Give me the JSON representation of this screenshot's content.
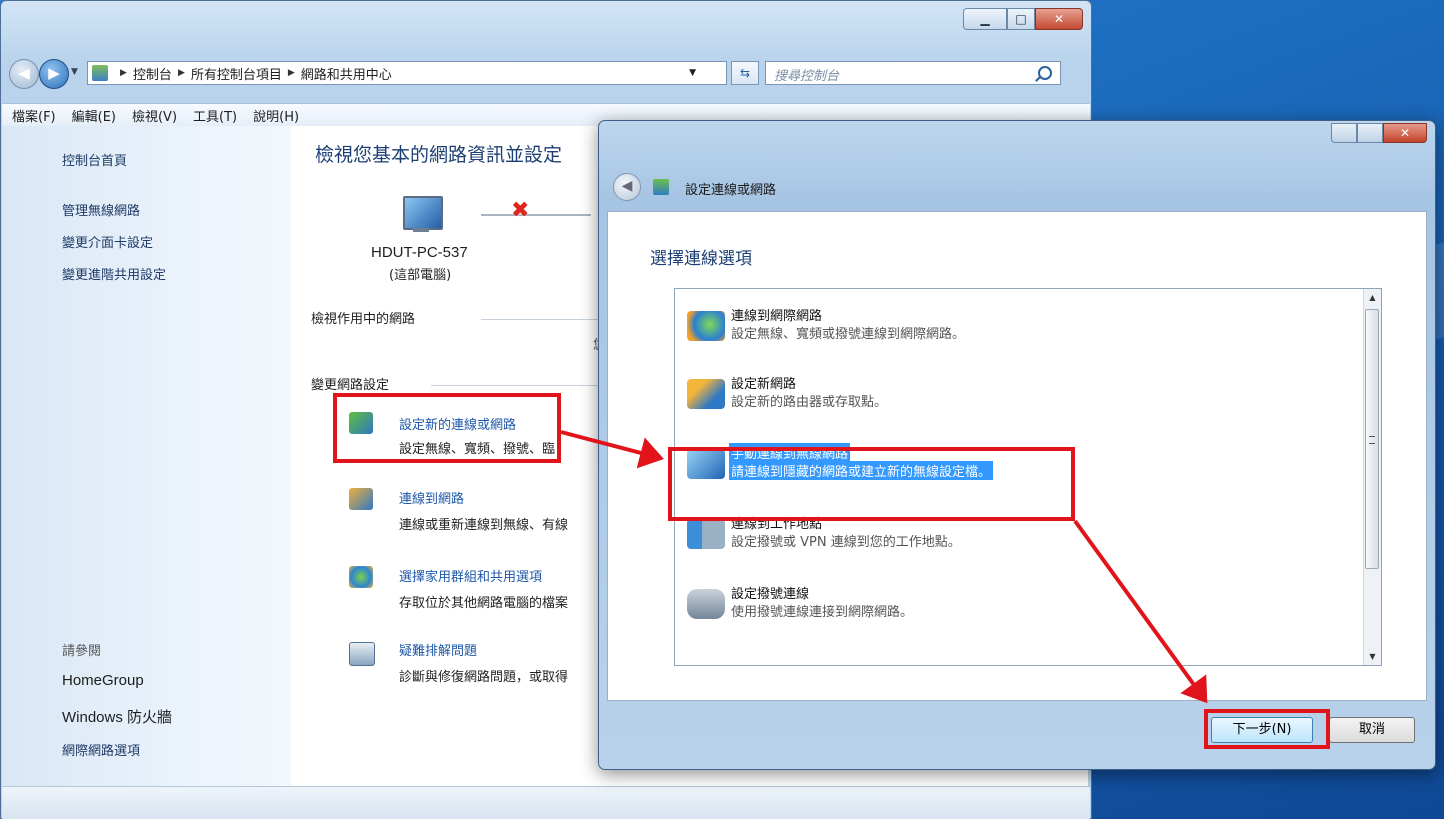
{
  "window": {
    "breadcrumb": [
      "控制台",
      "所有控制台項目",
      "網路和共用中心"
    ],
    "search_placeholder": "搜尋控制台",
    "menu": [
      "檔案(F)",
      "編輯(E)",
      "檢視(V)",
      "工具(T)",
      "說明(H)"
    ],
    "sidebar": {
      "home": "控制台首頁",
      "links": [
        "管理無線網路",
        "變更介面卡設定",
        "變更進階共用設定"
      ],
      "see_also_label": "請參閱",
      "see_also": [
        "HomeGroup",
        "Windows 防火牆",
        "網際網路選項"
      ]
    },
    "content": {
      "title": "檢視您基本的網路資訊並設定",
      "computer_name": "HDUT-PC-537",
      "computer_sub": "(這部電腦)",
      "active_networks_heading": "檢視作用中的網路",
      "active_networks_partial": "您",
      "change_settings_heading": "變更網路設定",
      "actions": [
        {
          "title": "設定新的連線或網路",
          "desc": "設定無線、寬頻、撥號、臨"
        },
        {
          "title": "連線到網路",
          "desc": "連線或重新連線到無線、有線"
        },
        {
          "title": "選擇家用群組和共用選項",
          "desc": "存取位於其他網路電腦的檔案"
        },
        {
          "title": "疑難排解問題",
          "desc": "診斷與修復網路問題，或取得"
        }
      ]
    }
  },
  "dialog": {
    "title": "設定連線或網路",
    "heading": "選擇連線選項",
    "options": [
      {
        "title": "連線到網際網路",
        "desc": "設定無線、寬頻或撥號連線到網際網路。",
        "icon": "globe-icon",
        "selected": false
      },
      {
        "title": "設定新網路",
        "desc": "設定新的路由器或存取點。",
        "icon": "router-icon",
        "selected": false
      },
      {
        "title": "手動連線到無線網路",
        "desc": "請連線到隱藏的網路或建立新的無線設定檔。",
        "icon": "wireless-computer-icon",
        "selected": true
      },
      {
        "title": "連線到工作地點",
        "desc": "設定撥號或 VPN 連線到您的工作地點。",
        "icon": "workplace-icon",
        "selected": false
      },
      {
        "title": "設定撥號連線",
        "desc": "使用撥號連線連接到網際網路。",
        "icon": "dialup-phone-icon",
        "selected": false
      }
    ],
    "next_label": "下一步(N)",
    "cancel_label": "取消"
  },
  "colors": {
    "annotation_red": "#e0141a",
    "selection_blue": "#3399ff",
    "link_blue": "#1e57a8"
  }
}
